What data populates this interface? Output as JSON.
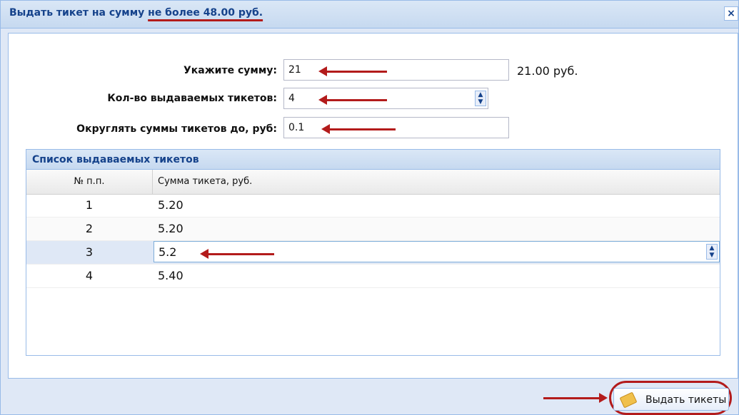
{
  "dialog": {
    "title_prefix": "Выдать тикет на сумму ",
    "title_limit": "не более 48.00 руб.",
    "close_label": "×"
  },
  "form": {
    "amount": {
      "label": "Укажите сумму:",
      "value": "21",
      "after": "21.00 руб."
    },
    "count": {
      "label": "Кол-во выдаваемых тикетов:",
      "value": "4"
    },
    "round": {
      "label": "Округлять суммы тикетов до, руб:",
      "value": "0.1"
    }
  },
  "grid": {
    "title": "Список выдаваемых тикетов",
    "columns": [
      "№ п.п.",
      "Сумма тикета, руб."
    ],
    "rows": [
      {
        "n": "1",
        "value": "5.20"
      },
      {
        "n": "2",
        "value": "5.20"
      },
      {
        "n": "3",
        "value": "5.2",
        "selected": true,
        "editing": true
      },
      {
        "n": "4",
        "value": "5.40"
      }
    ]
  },
  "footer": {
    "issue_button": "Выдать тикеты",
    "icon": "ticket-icon"
  },
  "colors": {
    "annotation": "#b31b1b",
    "window_border": "#99bbe8",
    "title_text": "#15428b",
    "selected_row": "#dfe8f6"
  }
}
